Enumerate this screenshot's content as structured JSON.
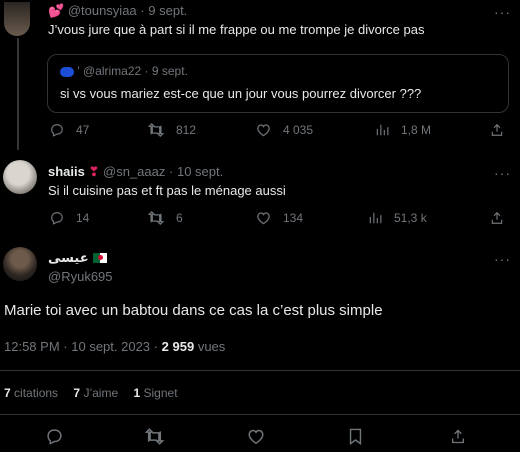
{
  "tweets": [
    {
      "handle": "@tounsyiaa",
      "sep": "·",
      "date": "9 sept.",
      "text": "J’vous jure que à part si il me frappe ou me trompe je divorce pas",
      "quote": {
        "handle": "@alrima22",
        "sep": "·",
        "date": "9 sept.",
        "text": "si vs vous mariez est-ce que un jour vous pourrez divorcer ???"
      },
      "replies": "47",
      "retweets": "812",
      "likes": "4 035",
      "views": "1,8 M"
    },
    {
      "name": "shaiis",
      "handle": "@sn_aaaz",
      "sep": "·",
      "date": "10 sept.",
      "text": "Si il cuisine pas et ft pas le ménage aussi",
      "replies": "14",
      "retweets": "6",
      "likes": "134",
      "views": "51,3 k"
    }
  ],
  "main_tweet": {
    "name": "عيسى",
    "handle": "@Ryuk695",
    "text": "Marie toi avec un babtou dans ce cas la c’est plus simple",
    "time": "12:58 PM",
    "sep": "·",
    "date": "10 sept. 2023",
    "sep2": "·",
    "views_count": "2 959",
    "views_label": "vues",
    "stats": {
      "quotes_count": "7",
      "quotes_label": "citations",
      "likes_count": "7",
      "likes_label": "J’aime",
      "bookmarks_count": "1",
      "bookmarks_label": "Signet"
    }
  },
  "icons": {
    "reply": "reply-icon",
    "retweet": "retweet-icon",
    "like": "heart-icon",
    "views": "views-icon",
    "share": "share-icon",
    "bookmark": "bookmark-icon",
    "more": "more-icon"
  },
  "colors": {
    "background": "#000000",
    "text": "#e7e9ea",
    "muted": "#71767b",
    "divider": "#2f3336",
    "accent_heart": "#f91880"
  }
}
